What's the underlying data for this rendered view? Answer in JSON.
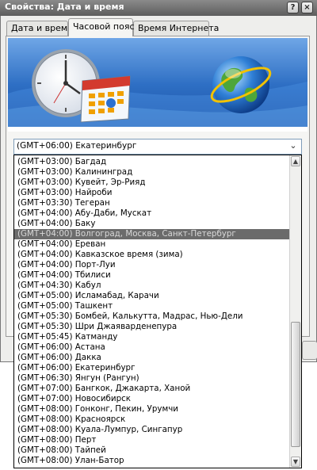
{
  "window": {
    "title": "Свойства: Дата и время",
    "help_glyph": "?",
    "close_glyph": "×"
  },
  "tabs": [
    {
      "label": "Дата и время",
      "active": false
    },
    {
      "label": "Часовой пояс",
      "active": true
    },
    {
      "label": "Время Интернета",
      "active": false
    }
  ],
  "timezone": {
    "selected": "(GMT+06:00) Екатеринбург",
    "highlighted_index": 7,
    "options": [
      "(GMT+03:00) Багдад",
      "(GMT+03:00) Калининград",
      "(GMT+03:00) Кувейт, Эр-Рияд",
      "(GMT+03:00) Найроби",
      "(GMT+03:30) Тегеран",
      "(GMT+04:00) Абу-Даби, Мускат",
      "(GMT+04:00) Баку",
      "(GMT+04:00) Волгоград, Москва, Санкт-Петербург",
      "(GMT+04:00) Ереван",
      "(GMT+04:00) Кавказское время (зима)",
      "(GMT+04:00) Порт-Луи",
      "(GMT+04:00) Тбилиси",
      "(GMT+04:30) Кабул",
      "(GMT+05:00) Исламабад, Карачи",
      "(GMT+05:00) Ташкент",
      "(GMT+05:30) Бомбей, Калькутта, Мадрас, Нью-Дели",
      "(GMT+05:30) Шри Джаявардeнепура",
      "(GMT+05:45) Катманду",
      "(GMT+06:00) Астана",
      "(GMT+06:00) Дакка",
      "(GMT+06:00) Екатеринбург",
      "(GMT+06:30) Янгун (Рангун)",
      "(GMT+07:00) Бангкок, Джакарта, Ханой",
      "(GMT+07:00) Новосибирск",
      "(GMT+08:00) Гонконг, Пекин, Урумчи",
      "(GMT+08:00) Красноярск",
      "(GMT+08:00) Куала-Лумпур, Сингапур",
      "(GMT+08:00) Перт",
      "(GMT+08:00) Тайпей",
      "(GMT+08:00) Улан-Батор"
    ]
  },
  "icons": {
    "clock": "clock-icon",
    "calendar": "calendar-icon",
    "globe": "globe-icon",
    "dropdown_arrow": "chevron-down-icon",
    "scroll_up": "scroll-up-arrow",
    "scroll_down": "scroll-down-arrow"
  },
  "colors": {
    "titlebar": "#6f6f6f",
    "banner_blue": "#2e6fc4",
    "selection": "#6b6b6b",
    "dialog_bg": "#eeeeec"
  }
}
